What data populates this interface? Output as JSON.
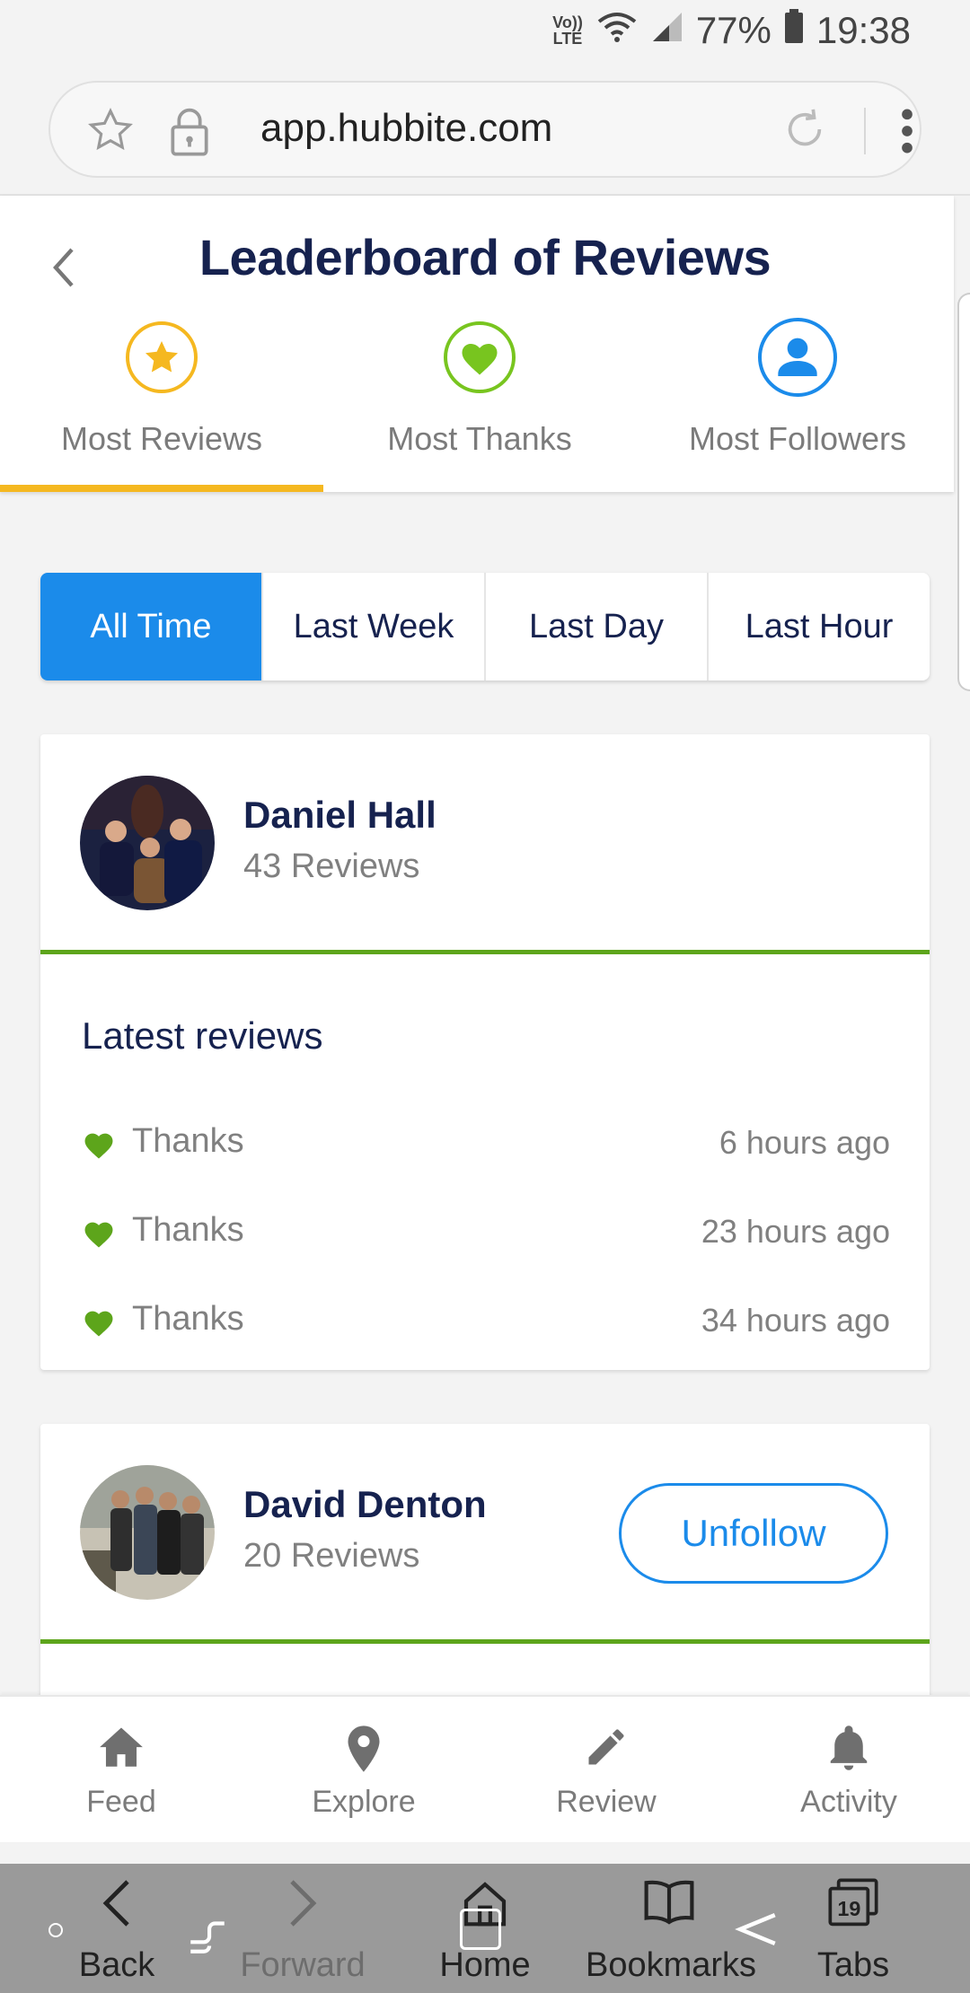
{
  "status_bar": {
    "network": "Vo)) LTE",
    "battery": "77%",
    "time": "19:38"
  },
  "browser": {
    "url": "app.hubbite.com"
  },
  "page": {
    "title": "Leaderboard of Reviews",
    "tabs": [
      {
        "label": "Most Reviews",
        "icon": "star-icon",
        "color": "#f5b820",
        "active": true
      },
      {
        "label": "Most Thanks",
        "icon": "heart-icon",
        "color": "#78c51f",
        "active": false
      },
      {
        "label": "Most Followers",
        "icon": "person-icon",
        "color": "#1b8bea",
        "active": false
      }
    ],
    "periods": [
      {
        "label": "All Time",
        "active": true
      },
      {
        "label": "Last Week",
        "active": false
      },
      {
        "label": "Last Day",
        "active": false
      },
      {
        "label": "Last Hour",
        "active": false
      }
    ],
    "leaders": [
      {
        "name": "Daniel Hall",
        "count": "43 Reviews",
        "latest_title": "Latest reviews",
        "reviews": [
          {
            "label": "Thanks",
            "time": "6 hours ago"
          },
          {
            "label": "Thanks",
            "time": "23 hours ago"
          },
          {
            "label": "Thanks",
            "time": "34 hours ago"
          }
        ]
      },
      {
        "name": "David Denton",
        "count": "20 Reviews",
        "action": "Unfollow"
      }
    ]
  },
  "bottom_nav": [
    {
      "label": "Feed",
      "icon": "home-icon"
    },
    {
      "label": "Explore",
      "icon": "map-pin-icon"
    },
    {
      "label": "Review",
      "icon": "pencil-icon"
    },
    {
      "label": "Activity",
      "icon": "bell-icon"
    }
  ],
  "browser_toolbar": {
    "back": "Back",
    "forward": "Forward",
    "home": "Home",
    "bookmarks": "Bookmarks",
    "tabs": "Tabs",
    "tab_count": "19"
  },
  "colors": {
    "accent_blue": "#1b8bea",
    "accent_yellow": "#f5b820",
    "accent_green": "#5da51b",
    "title_navy": "#16224f"
  }
}
